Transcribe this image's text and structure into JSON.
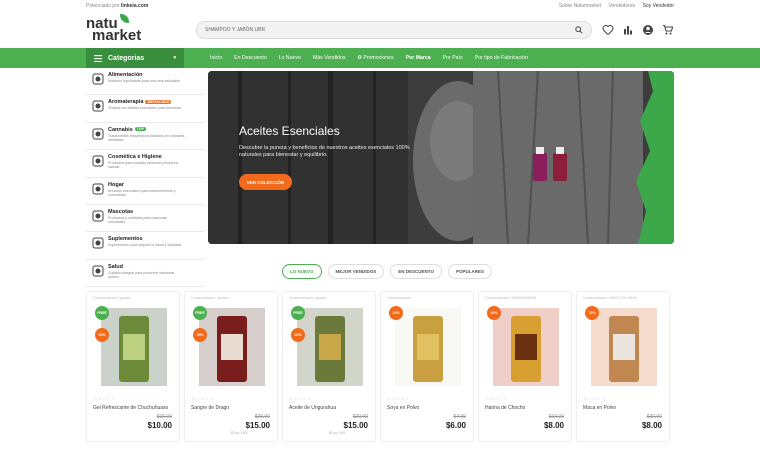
{
  "topbar": {
    "powered_prefix": "Potenciado por",
    "powered_brand": "linkeia.com",
    "links": [
      "Sobre Naturmarket",
      "Vendedores",
      "Soy Vendedor"
    ]
  },
  "header": {
    "logo_line1": "natu",
    "logo_line2": "market",
    "search_placeholder": "SHAMPOO Y JABÓN UBR"
  },
  "nav": {
    "categories_label": "Categorias",
    "links": [
      "Inicio",
      "En Descuento",
      "Lo Nuevo",
      "Más Vendidos",
      "Promociones",
      "Por Marca",
      "Por País",
      "Por tipo de Fabricación"
    ],
    "accent": "#4caf50",
    "dark_accent": "#3a8f3e"
  },
  "sidebar": {
    "items": [
      {
        "label": "Alimentación",
        "desc": "Nutrición equilibrada para una vida saludable.",
        "tag": ""
      },
      {
        "label": "Aromaterapia",
        "desc": "Terapia con aceites esenciales para bienestar.",
        "tag": "DESTACADO"
      },
      {
        "label": "Cannabis",
        "desc": "Tratamientos terapéuticos basados en cannabis medicinal.",
        "tag": "TOP"
      },
      {
        "label": "Cosmética e Higiene",
        "desc": "Productos para cuidado personal y limpieza natural.",
        "tag": ""
      },
      {
        "label": "Hogar",
        "desc": "Artículos esenciales para mantenimiento y comodidad.",
        "tag": ""
      },
      {
        "label": "Mascotas",
        "desc": "Productos y cuidados para mascotas saludables.",
        "tag": ""
      },
      {
        "label": "Suplementos",
        "desc": "Suplementos para mejorar la salud y vitalidad.",
        "tag": ""
      },
      {
        "label": "Salud",
        "desc": "Cuidado integral para promover bienestar óptimo.",
        "tag": ""
      }
    ]
  },
  "hero": {
    "title": "Aceites Esenciales",
    "subtitle": "Descubre la pureza y beneficios de nuestros aceites esenciales 100% naturales para bienestar y equilibrio.",
    "cta": "VER COLECCIÓN"
  },
  "tabs": [
    "LO NUEVO",
    "MEJOR VENDIDOS",
    "EN DESCUENTO",
    "POPULARES"
  ],
  "products": [
    {
      "brand": "Comercializado: Ignaciu",
      "name": "Gel Refrescante de Chuchuhuaso",
      "old": "$15.00",
      "price": "$10.00",
      "unit": "",
      "discount": "33%",
      "free": "FREE",
      "stars": "☆☆☆☆☆"
    },
    {
      "brand": "Comercializado: Ignaciu",
      "name": "Sangre de Drago",
      "old": "$20.00",
      "price": "$15.00",
      "unit": "$0.xx/ 1 ML",
      "discount": "25%",
      "free": "FREE",
      "stars": "☆☆☆☆☆"
    },
    {
      "brand": "Comercializado: Ignaciu",
      "name": "Aceite de Ungurahua",
      "old": "$20.00",
      "price": "$15.00",
      "unit": "$0.xx/ 1 ML",
      "discount": "25%",
      "free": "FREE",
      "stars": "☆☆☆☆☆"
    },
    {
      "brand": "Comercializado:",
      "name": "Soya en Polvo",
      "old": "$7.00",
      "price": "$6.00",
      "unit": "",
      "discount": "14%",
      "free": "",
      "stars": "☆☆☆☆☆"
    },
    {
      "brand": "Comercializado: INDEMAXIMUM",
      "name": "Harina de Chocho",
      "old": "$10.00",
      "price": "$8.00",
      "unit": "",
      "discount": "20%",
      "free": "",
      "stars": "☆☆☆☆☆"
    },
    {
      "brand": "Comercializado: INDIO COLONIAL",
      "name": "Maca en Polvo",
      "old": "$30.00",
      "price": "$8.00",
      "unit": "",
      "discount": "73%",
      "free": "",
      "stars": "☆☆☆☆☆"
    }
  ],
  "colors": {
    "orange": "#f26a1b",
    "green": "#4caf50"
  }
}
